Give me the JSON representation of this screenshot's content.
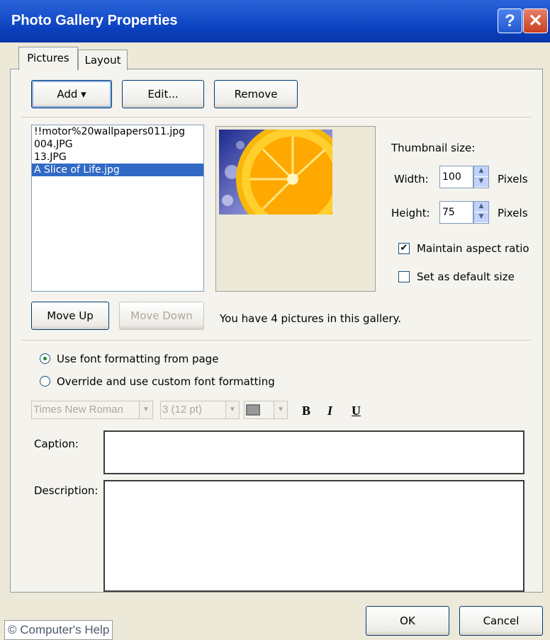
{
  "window": {
    "title": "Photo Gallery Properties",
    "help_glyph": "?",
    "close_glyph": "✕"
  },
  "tabs": [
    {
      "label": "Pictures",
      "active": true
    },
    {
      "label": "Layout",
      "active": false
    }
  ],
  "toolbar": {
    "add_label": "Add ▾",
    "edit_label": "Edit...",
    "remove_label": "Remove"
  },
  "pictures": {
    "files": [
      "!!motor%20wallpapers011.jpg",
      "004.JPG",
      "13.JPG",
      "A Slice of Life.jpg"
    ],
    "selected_index": 3
  },
  "thumbnail": {
    "heading": "Thumbnail size:",
    "width_label": "Width:",
    "width_value": "100",
    "width_unit": "Pixels",
    "height_label": "Height:",
    "height_value": "75",
    "height_unit": "Pixels",
    "maintain_aspect_label": "Maintain aspect ratio",
    "maintain_aspect_checked": true,
    "default_size_label": "Set as default size",
    "default_size_checked": false
  },
  "order": {
    "move_up_label": "Move Up",
    "move_down_label": "Move Down",
    "count_text": "You have 4 pictures in this gallery."
  },
  "font_options": {
    "use_page_label": "Use font formatting from page",
    "override_label": "Override and use custom font formatting",
    "selected": "use_page",
    "font_name": "Times New Roman",
    "font_size": "3  (12 pt)",
    "bold_label": "B",
    "italic_label": "I",
    "underline_label": "U"
  },
  "caption_label": "Caption:",
  "description_label": "Description:",
  "footer": {
    "ok_label": "OK",
    "cancel_label": "Cancel"
  },
  "watermark": "© Computer's Help"
}
